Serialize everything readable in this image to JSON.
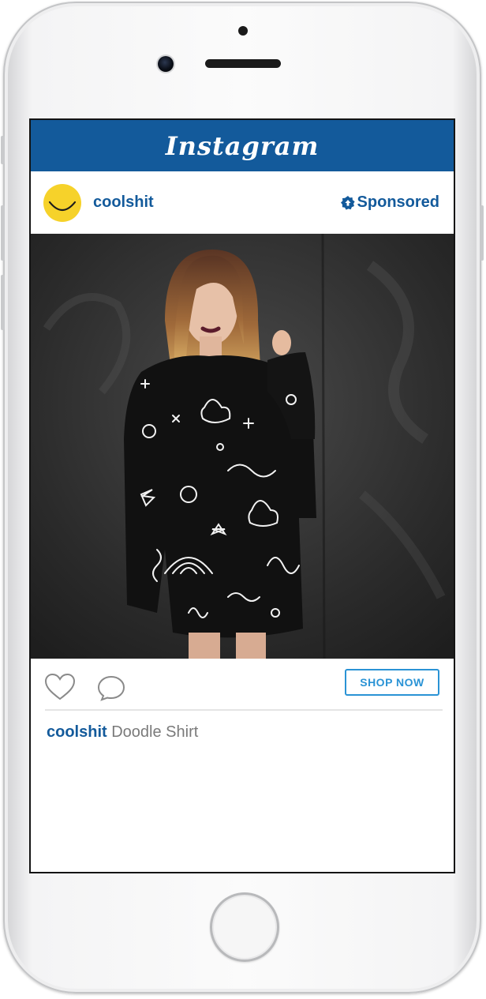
{
  "app": {
    "logo_text": "Instagram",
    "brand_color": "#135a9b"
  },
  "post": {
    "username": "coolshit",
    "sponsored_label": "Sponsored",
    "avatar_icon": "smiley-face-icon",
    "avatar_color": "#f6d22a",
    "image_description_icon": "doodle-shirt-photo",
    "like_icon": "heart-icon",
    "comment_icon": "comment-bubble-icon",
    "shop_button_label": "SHOP NOW",
    "shop_button_color": "#2a93d5",
    "caption_username": "coolshit",
    "caption_text": "Doodle Shirt"
  }
}
